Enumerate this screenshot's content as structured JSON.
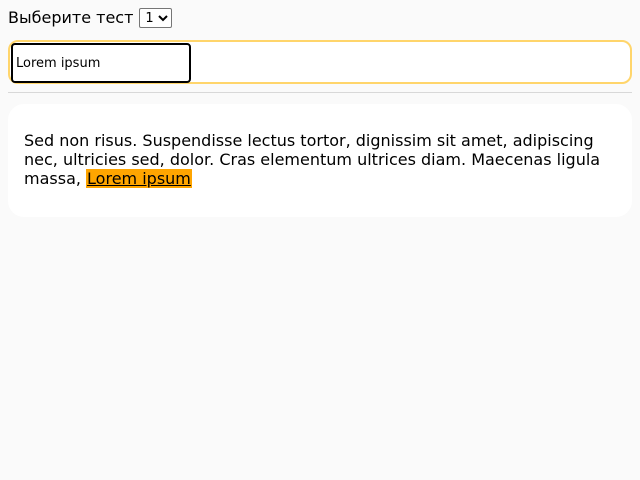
{
  "header": {
    "test_label": "Выберите тест",
    "test_select": {
      "selected": "1",
      "options": [
        "1"
      ]
    }
  },
  "search": {
    "value": "Lorem ipsum",
    "placeholder": ""
  },
  "content": {
    "text_before": "Sed non risus. Suspendisse lectus tortor, dignissim sit amet, adipiscing nec, ultricies sed, dolor. Cras elementum ultrices diam. Maecenas ligula massa, ",
    "highlight": "Lorem ipsum"
  },
  "colors": {
    "highlight": "#ffa500",
    "focus_ring": "#ffd56b",
    "page_background": "#fafafa"
  }
}
